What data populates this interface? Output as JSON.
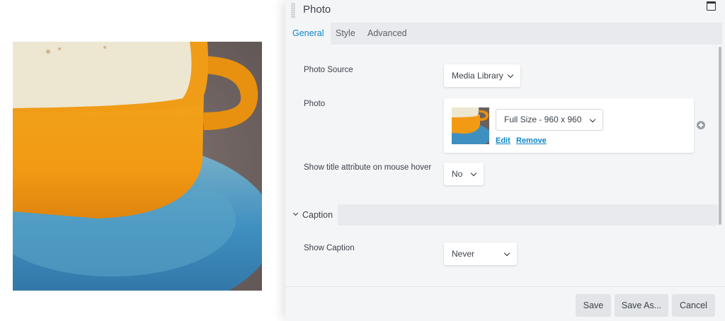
{
  "panel": {
    "title": "Photo",
    "tabs": [
      "General",
      "Style",
      "Advanced"
    ]
  },
  "fields": {
    "photo_source": {
      "label": "Photo Source",
      "value": "Media Library"
    },
    "photo": {
      "label": "Photo",
      "size_value": "Full Size - 960 x 960",
      "edit_link": "Edit",
      "remove_link": "Remove"
    },
    "title_hover": {
      "label": "Show title attribute on mouse hover",
      "value": "No"
    }
  },
  "caption_section": {
    "title": "Caption",
    "show_caption": {
      "label": "Show Caption",
      "value": "Never"
    }
  },
  "footer": {
    "save": "Save",
    "save_as": "Save As...",
    "cancel": "Cancel"
  },
  "colors": {
    "accent": "#0e86c8",
    "panel_bg": "#f4f5f7",
    "tab_bar_bg": "#e8eaee",
    "button_bg": "#e2e4e7"
  },
  "icons": [
    "drag-handle-icon",
    "window-icon",
    "chevron-down-icon",
    "add-circle-icon"
  ]
}
